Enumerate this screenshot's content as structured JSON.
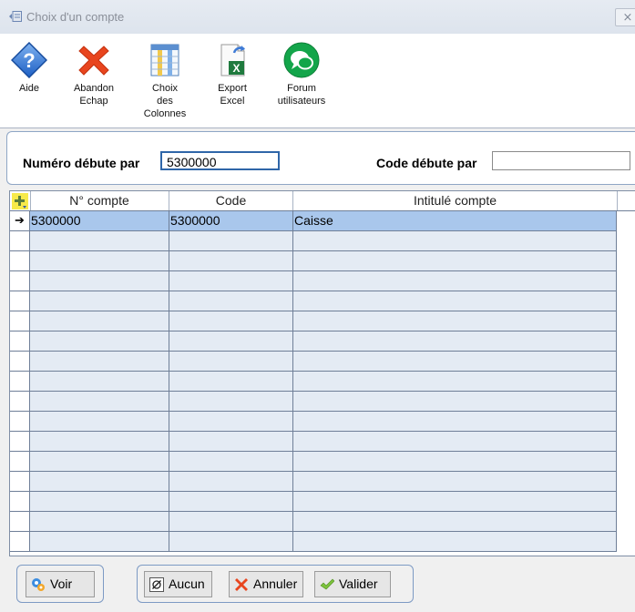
{
  "window": {
    "title": "Choix d'un compte",
    "close_glyph": "⨯"
  },
  "toolbar": {
    "aide": "Aide",
    "abandon": "Abandon",
    "abandon_sub": "Echap",
    "choix": "Choix",
    "choix_sub": "des",
    "choix_sub2": "Colonnes",
    "export": "Export",
    "export_sub": "Excel",
    "forum": "Forum",
    "forum_sub": "utilisateurs"
  },
  "filters": {
    "numero_label": "Numéro débute par",
    "numero_value": "5300000",
    "code_label": "Code débute par",
    "code_value": ""
  },
  "grid": {
    "columns": [
      "N° compte",
      "Code",
      "Intitulé compte"
    ],
    "rows": [
      {
        "numero": "5300000",
        "code": "5300000",
        "intitule": "Caisse"
      }
    ],
    "current_row_marker": "➔",
    "add_column_glyph": "+"
  },
  "buttons": {
    "voir": "Voir",
    "aucun": "Aucun",
    "annuler": "Annuler",
    "valider": "Valider"
  },
  "icons": [
    "help-icon",
    "cancel-icon",
    "columns-icon",
    "excel-icon",
    "forum-icon",
    "voir-icon",
    "aucun-icon",
    "annuler-icon",
    "valider-icon"
  ]
}
